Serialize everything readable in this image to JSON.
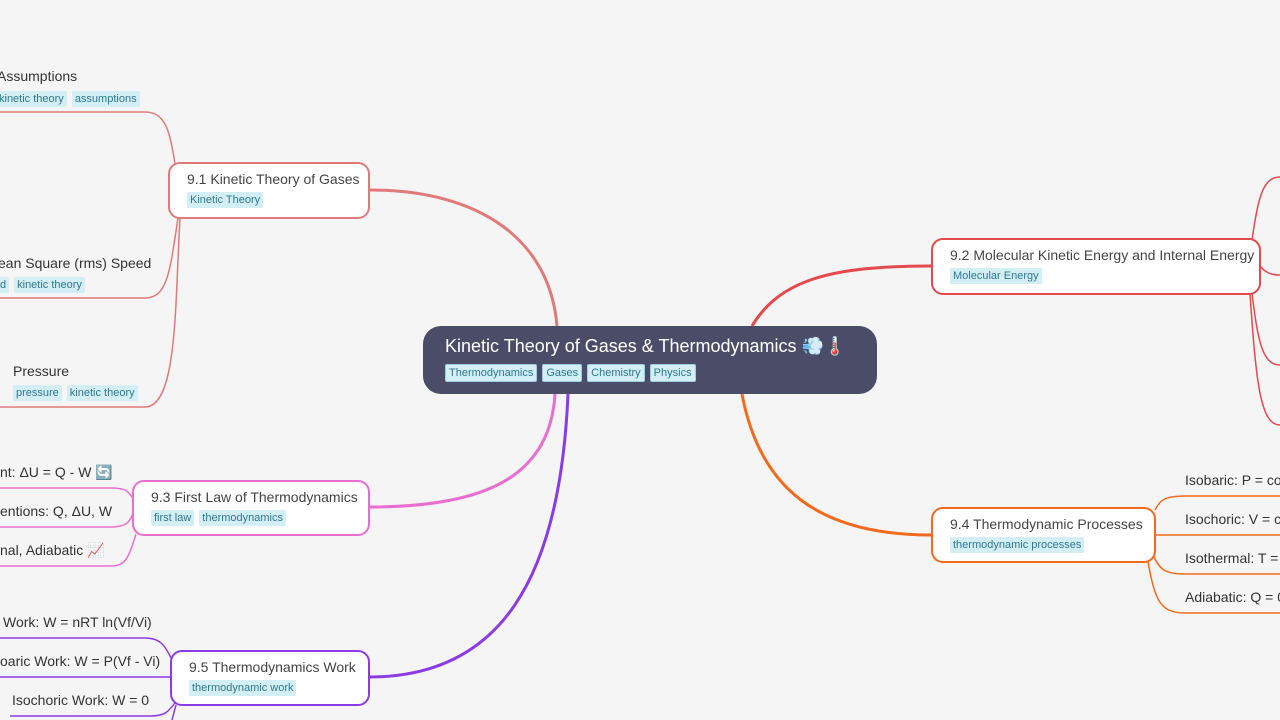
{
  "colors": {
    "center": "#4b4d68",
    "b91": "#e07a7a",
    "b92": "#e5484d",
    "b93": "#e86fd0",
    "b94": "#f26a1d",
    "b95": "#8b3be6"
  },
  "center": {
    "title": "Kinetic Theory of Gases & Thermodynamics 💨🌡️",
    "tags": [
      "Thermodynamics",
      "Gases",
      "Chemistry",
      "Physics"
    ]
  },
  "b91": {
    "title": "9.1 Kinetic Theory of Gases",
    "tags": [
      "Kinetic Theory"
    ],
    "leaves": [
      {
        "text": "Assumptions",
        "tags": [
          "kinetic theory",
          "assumptions"
        ]
      },
      {
        "text": "ean Square (rms) Speed",
        "tags": [
          "d",
          "kinetic theory"
        ]
      },
      {
        "text": "Pressure",
        "tags": [
          "pressure",
          "kinetic theory"
        ]
      }
    ]
  },
  "b92": {
    "title": "9.2 Molecular Kinetic Energy and Internal Energy",
    "tags": [
      "Molecular Energy"
    ]
  },
  "b93": {
    "title": "9.3 First Law of Thermodynamics",
    "tags": [
      "first law",
      "thermodynamics"
    ],
    "leaves": [
      "nt: ΔU = Q - W 🔄",
      "entions:  Q, ΔU, W",
      "nal, Adiabatic 📈"
    ]
  },
  "b94": {
    "title": "9.4 Thermodynamic Processes",
    "tags": [
      "thermodynamic processes"
    ],
    "leaves": [
      "Isobaric: P = con",
      "Isochoric: V = co",
      "Isothermal: T = c",
      "Adiabatic: Q = 0"
    ]
  },
  "b95": {
    "title": "9.5 Thermodynamics Work",
    "tags": [
      "thermodynamic work"
    ],
    "leaves": [
      "Work: W = nRT ln(Vf/Vi)",
      "oaric Work: W = P(Vf - Vi)",
      "Isochoric Work: W = 0"
    ]
  }
}
